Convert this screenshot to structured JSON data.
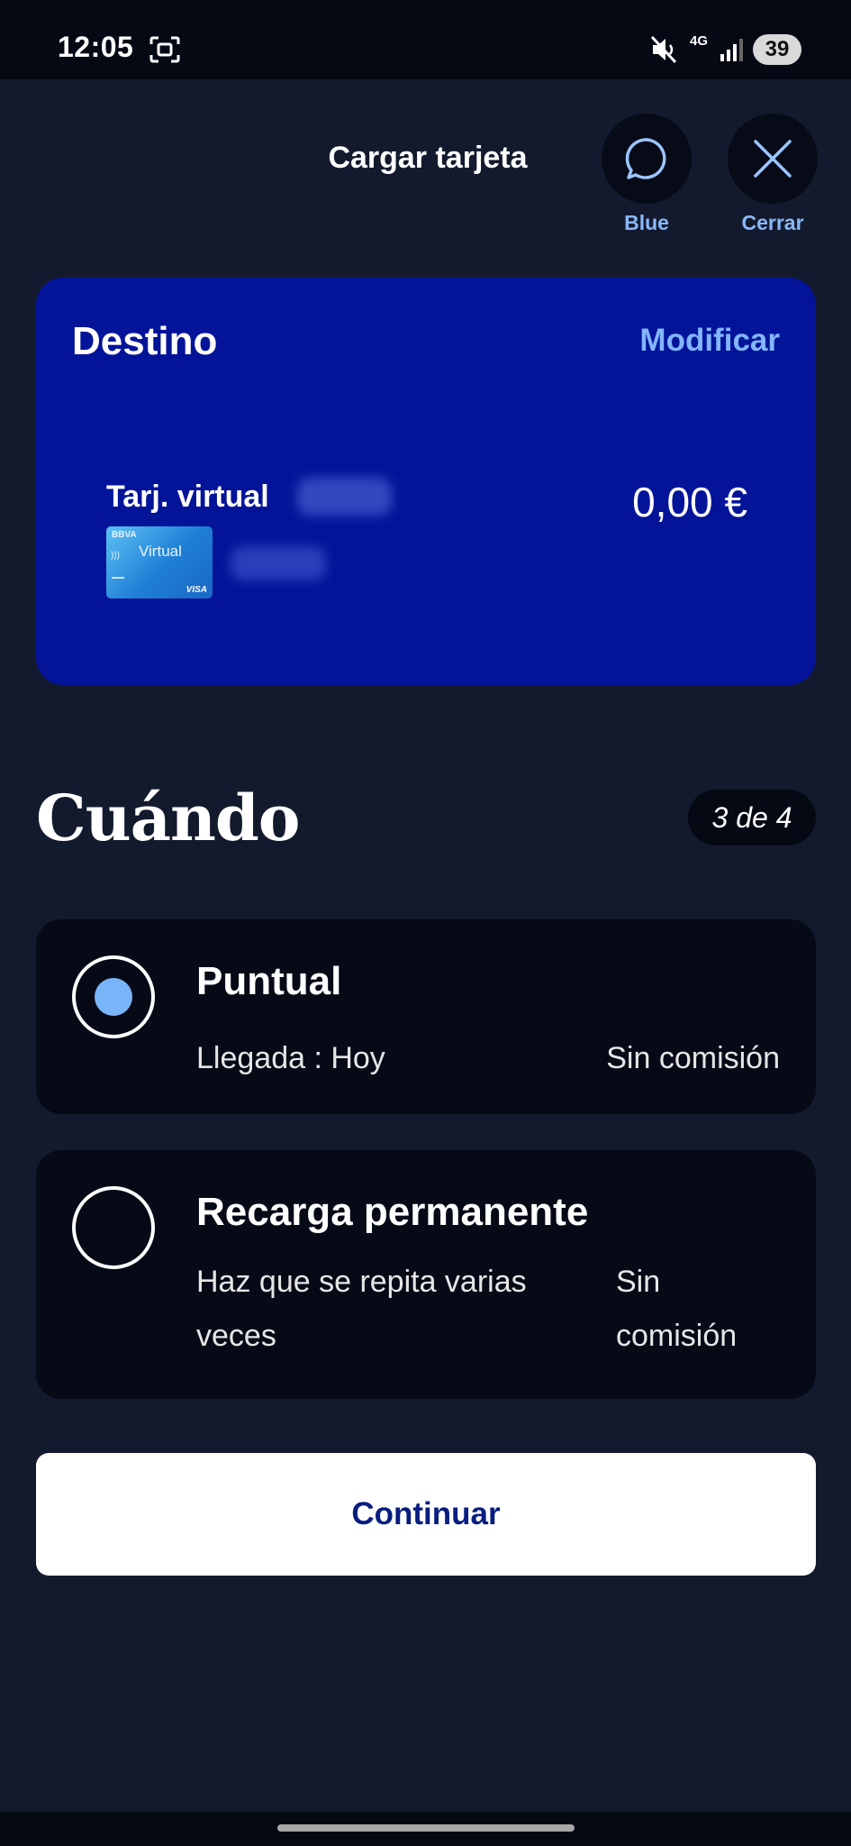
{
  "status_bar": {
    "time": "12:05",
    "network": "4G",
    "battery": "39",
    "icons": [
      "screenshot-icon",
      "mute-icon",
      "signal-icon"
    ]
  },
  "header": {
    "title": "Cargar tarjeta",
    "blue_label": "Blue",
    "close_label": "Cerrar"
  },
  "destination": {
    "title": "Destino",
    "modify_label": "Modificar",
    "card_name": "Tarj. virtual",
    "amount": "0,00 €",
    "thumb": {
      "bank": "BBVA",
      "label": "Virtual",
      "network": "VISA"
    },
    "background_color": "#041499"
  },
  "section": {
    "title": "Cuándo",
    "step": "3 de 4"
  },
  "options": [
    {
      "title": "Puntual",
      "subtitle": "Llegada : Hoy",
      "fee": "Sin comisión",
      "selected": true
    },
    {
      "title": "Recarga permanente",
      "subtitle": "Haz que se repita varias veces",
      "fee": "Sin comisión",
      "selected": false
    }
  ],
  "continue_label": "Continuar",
  "colors": {
    "background": "#131a2d",
    "accent_blue": "#83b5ff",
    "radio_selected": "#7ab4f8",
    "button_text": "#071d80"
  }
}
